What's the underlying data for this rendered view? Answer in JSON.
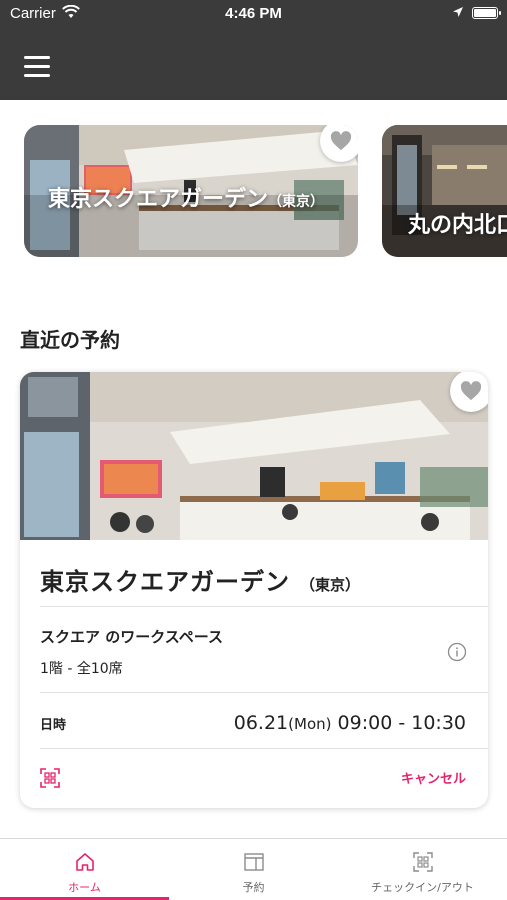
{
  "status_bar": {
    "carrier": "Carrier",
    "time": "4:46 PM"
  },
  "featured": [
    {
      "name": "東京スクエアガーデン",
      "area": "（東京）"
    },
    {
      "name": "丸の内北口",
      "area": ""
    }
  ],
  "section": {
    "title": "直近の予約"
  },
  "reservation": {
    "venue": "東京スクエアガーデン",
    "area": "（東京）",
    "space": "スクエア のワークスペース",
    "seat": "1階 - 全10席",
    "date_label": "日時",
    "date": "06.21",
    "weekday": "(Mon)",
    "time_range": "09:00 - 10:30",
    "cancel_label": "キャンセル"
  },
  "tabs": [
    {
      "label": "ホーム",
      "icon": "home-icon",
      "active": true
    },
    {
      "label": "予約",
      "icon": "reservation-icon",
      "active": false
    },
    {
      "label": "チェックイン/アウト",
      "icon": "qr-scan-icon",
      "active": false
    }
  ],
  "colors": {
    "accent": "#e4246c",
    "nav_bg": "#3b3b3b"
  }
}
